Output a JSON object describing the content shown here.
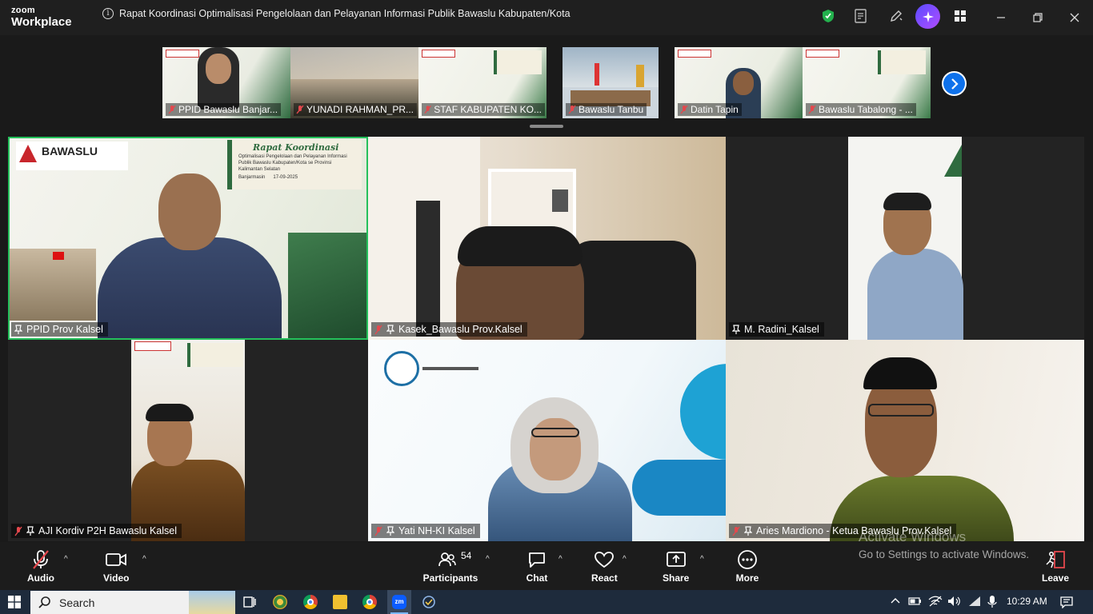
{
  "app": {
    "logo_line1": "zoom",
    "logo_line2": "Workplace",
    "meeting_title": "Rapat Koordinasi Optimalisasi Pengelolaan dan Pelayanan Informasi Publik Bawaslu Kabupaten/Kota"
  },
  "filmstrip": [
    {
      "name": "PPID Bawaslu Banjar..."
    },
    {
      "name": "YUNADI RAHMAN_PR..."
    },
    {
      "name": "STAF KABUPATEN KO..."
    },
    {
      "name": "Bawaslu Tanbu"
    },
    {
      "name": "Datin Tapin"
    },
    {
      "name": "Bawaslu Tabalong - ..."
    }
  ],
  "tiles": [
    {
      "name": "PPID Prov Kalsel"
    },
    {
      "name": "Kasek_Bawaslu Prov.Kalsel"
    },
    {
      "name": "M. Radini_Kalsel"
    },
    {
      "name": "AJI Kordiv P2H Bawaslu Kalsel"
    },
    {
      "name": "Yati NH-KI Kalsel"
    },
    {
      "name": "Aries Mardiono - Ketua Bawaslu Prov.Kalsel"
    }
  ],
  "banner": {
    "org": "BAWASLU",
    "event": "Rapat Koordinasi",
    "subtitle": "Optimalisasi Pengelolaan dan Pelayanan Informasi Publik Bawaslu Kabupaten/Kota se Provinsi Kalimantan Selatan",
    "place": "Banjarmasin",
    "date": "17-09-2025"
  },
  "toolbar": {
    "audio": "Audio",
    "video": "Video",
    "participants": "Participants",
    "participants_count": "54",
    "chat": "Chat",
    "react": "React",
    "share": "Share",
    "more": "More",
    "leave": "Leave"
  },
  "watermark": {
    "line1": "Activate Windows",
    "line2": "Go to Settings to activate Windows."
  },
  "taskbar": {
    "search": "Search",
    "time": "10:29 AM"
  },
  "colors": {
    "accent": "#0e71eb",
    "active_speaker": "#24c05b",
    "mute_red": "#e5484d"
  }
}
